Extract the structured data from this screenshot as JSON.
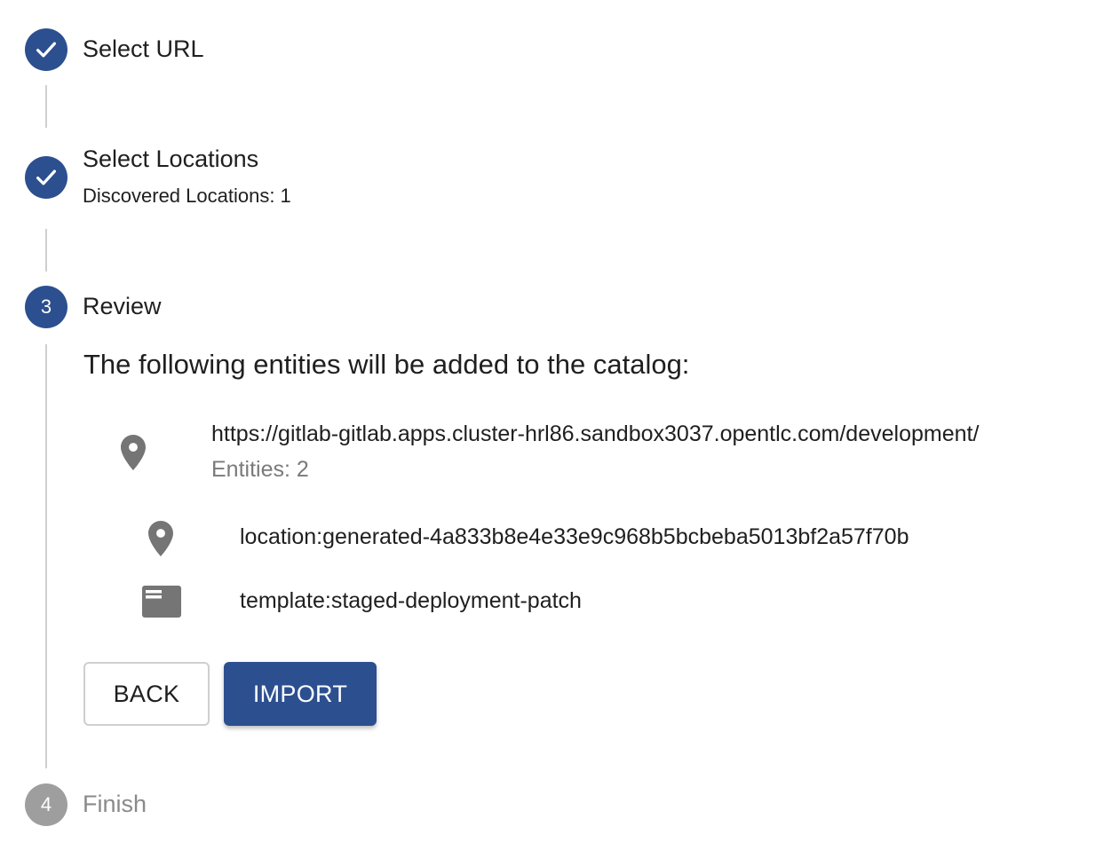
{
  "steps": [
    {
      "label": "Select URL",
      "state": "done"
    },
    {
      "label": "Select Locations",
      "state": "done",
      "sublabel": "Discovered Locations: 1"
    },
    {
      "label": "Review",
      "state": "active",
      "number": "3"
    },
    {
      "label": "Finish",
      "state": "pending",
      "number": "4"
    }
  ],
  "review": {
    "intro": "The following entities will be added to the catalog:",
    "location": {
      "url": "https://gitlab-gitlab.apps.cluster-hrl86.sandbox3037.opentlc.com/development/",
      "count_text": "Entities: 2",
      "icon": "map-pin-icon"
    },
    "entities": [
      {
        "name": "location:generated-4a833b8e4e33e9c968b5bcbeba5013bf2a57f70b",
        "icon": "map-pin-icon"
      },
      {
        "name": "template:staged-deployment-patch",
        "icon": "template-icon"
      }
    ]
  },
  "buttons": {
    "back": "BACK",
    "import": "IMPORT"
  },
  "colors": {
    "primary": "#2c4f8f",
    "pending": "#9e9e9e",
    "connector": "#cfcfcf",
    "icon": "#757575"
  }
}
